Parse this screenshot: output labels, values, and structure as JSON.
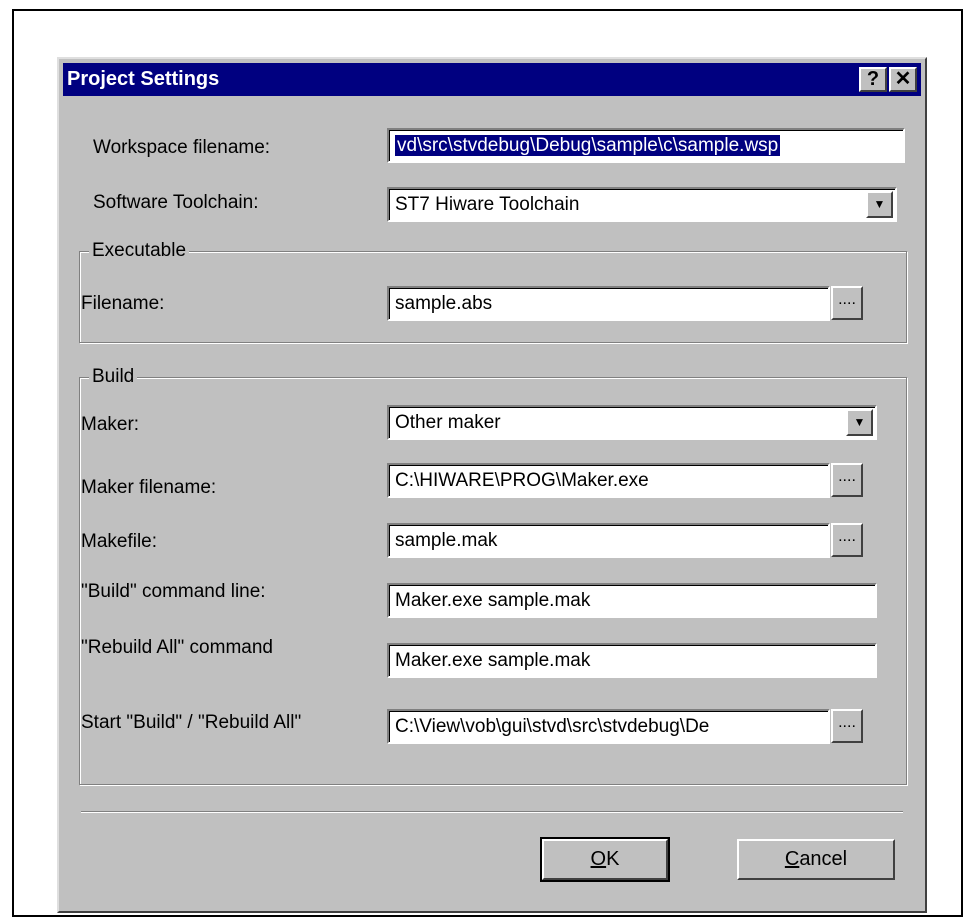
{
  "dialog": {
    "title": "Project Settings",
    "help_glyph": "?",
    "close_glyph": "✕"
  },
  "workspace": {
    "label": "Workspace filename:",
    "value": "vd\\src\\stvdebug\\Debug\\sample\\c\\sample.wsp"
  },
  "toolchain": {
    "label": "Software Toolchain:",
    "value": "ST7 Hiware Toolchain"
  },
  "executable": {
    "group_title": "Executable",
    "filename_label": "Filename:",
    "filename_value": "sample.abs",
    "browse_label": "...."
  },
  "build": {
    "group_title": "Build",
    "maker_label": "Maker:",
    "maker_value": "Other maker",
    "maker_filename_label": "Maker filename:",
    "maker_filename_value": "C:\\HIWARE\\PROG\\Maker.exe",
    "makefile_label": "Makefile:",
    "makefile_value": "sample.mak",
    "build_cmd_label": "\"Build\" command line:",
    "build_cmd_value": "Maker.exe sample.mak",
    "rebuild_cmd_label": "\"Rebuild All\" command",
    "rebuild_cmd_value": "Maker.exe sample.mak",
    "start_label": "Start \"Build\" / \"Rebuild All\"",
    "start_value": "C:\\View\\vob\\gui\\stvd\\src\\stvdebug\\De",
    "browse_label": "...."
  },
  "buttons": {
    "ok_mnemonic": "O",
    "ok_rest": "K",
    "cancel_mnemonic": "C",
    "cancel_rest": "ancel"
  },
  "icons": {
    "dropdown": "chevron-down-icon"
  }
}
